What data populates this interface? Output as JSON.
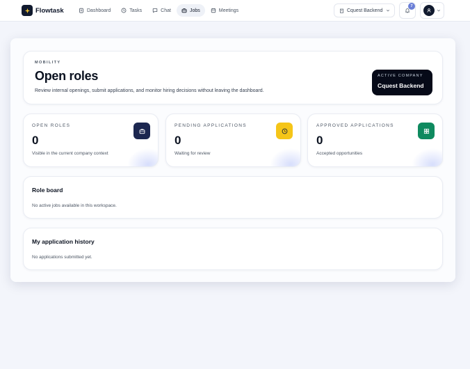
{
  "brand": {
    "name": "Flowtask"
  },
  "nav": [
    {
      "label": "Dashboard",
      "icon": "clipboard-icon"
    },
    {
      "label": "Tasks",
      "icon": "clock-icon"
    },
    {
      "label": "Chat",
      "icon": "chat-icon"
    },
    {
      "label": "Jobs",
      "icon": "briefcase-icon",
      "active": true
    },
    {
      "label": "Meetings",
      "icon": "calendar-icon"
    }
  ],
  "header": {
    "company_select": "Cquest Backend",
    "notification_count": "7"
  },
  "hero": {
    "eyebrow": "MOBILITY",
    "title": "Open roles",
    "subtitle": "Review internal openings, submit applications, and monitor hiring decisions without leaving the dashboard.",
    "active_company_label": "ACTIVE COMPANY",
    "active_company_name": "Cquest Backend"
  },
  "stats": [
    {
      "label": "OPEN ROLES",
      "value": "0",
      "sub": "Visible in the current company context",
      "icon": "briefcase-icon",
      "color": "#1c2750"
    },
    {
      "label": "PENDING APPLICATIONS",
      "value": "0",
      "sub": "Waiting for review",
      "icon": "clock-icon",
      "color": "#f5c518"
    },
    {
      "label": "APPROVED APPLICATIONS",
      "value": "0",
      "sub": "Accepted opportunities",
      "icon": "grid-icon",
      "color": "#0f8a5f"
    }
  ],
  "role_board": {
    "title": "Role board",
    "empty": "No active jobs available in this workspace."
  },
  "history": {
    "title": "My application history",
    "empty": "No applications submitted yet."
  }
}
